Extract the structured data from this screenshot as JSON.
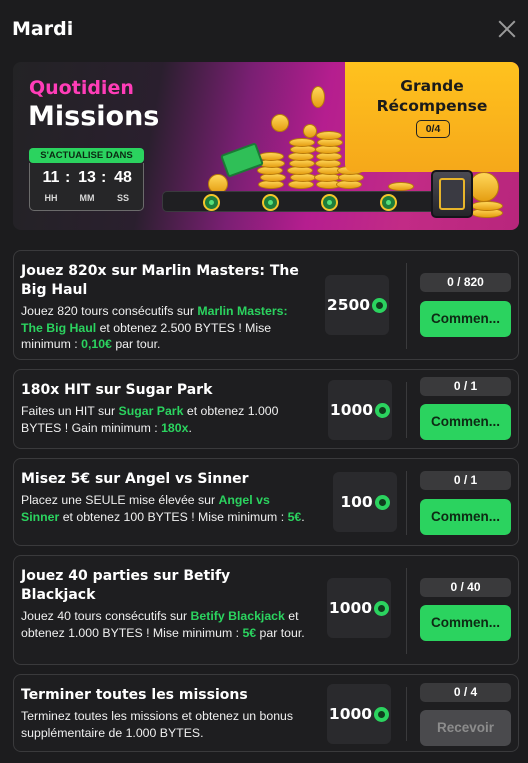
{
  "header": {
    "title": "Mardi"
  },
  "banner": {
    "label_top": "Quotidien",
    "label_main": "Missions",
    "refresh_label": "S'ACTUALISE DANS",
    "timer": {
      "hh": "11",
      "mm": "13",
      "ss": "48",
      "hh_label": "HH",
      "mm_label": "MM",
      "ss_label": "SS",
      "sep": ":"
    },
    "reward": {
      "title_line1": "Grande",
      "title_line2": "Récompense",
      "count": "0/4"
    },
    "progress_fraction": 0
  },
  "missions": [
    {
      "title": "Jouez 820x sur Marlin Masters: The Big Haul",
      "desc": [
        {
          "t": "Jouez 820 tours consécutifs sur "
        },
        {
          "t": "Marlin Masters: The Big Haul",
          "c": "hl"
        },
        {
          "t": " et obtenez 2.500 BYTES ! Mise minimum : "
        },
        {
          "t": "0,10€",
          "c": "hl"
        },
        {
          "t": " par tour."
        }
      ],
      "amount": "2500",
      "progress": "0 / 820",
      "button": "Commen...",
      "enabled": true
    },
    {
      "title": "180x HIT sur Sugar Park",
      "desc": [
        {
          "t": "Faites un HIT sur "
        },
        {
          "t": "Sugar Park",
          "c": "hl"
        },
        {
          "t": " et obtenez 1.000 BYTES ! Gain minimum : "
        },
        {
          "t": "180x",
          "c": "hl"
        },
        {
          "t": "."
        }
      ],
      "amount": "1000",
      "progress": "0 / 1",
      "button": "Commen...",
      "enabled": true
    },
    {
      "title": "Misez 5€ sur Angel vs Sinner",
      "desc": [
        {
          "t": "Placez une SEULE mise élevée sur "
        },
        {
          "t": "Angel vs Sinner",
          "c": "hl"
        },
        {
          "t": " et obtenez 100 BYTES ! Mise minimum : "
        },
        {
          "t": "5€",
          "c": "hl"
        },
        {
          "t": "."
        }
      ],
      "amount": "100",
      "progress": "0 / 1",
      "button": "Commen...",
      "enabled": true
    },
    {
      "title": "Jouez 40 parties sur Betify Blackjack",
      "desc": [
        {
          "t": "Jouez 40 tours consécutifs sur "
        },
        {
          "t": "Betify Blackjack",
          "c": "hl"
        },
        {
          "t": " et obtenez 1.000 BYTES ! Mise minimum : "
        },
        {
          "t": "5€",
          "c": "hl"
        },
        {
          "t": " par tour."
        }
      ],
      "amount": "1000",
      "progress": "0 / 40",
      "button": "Commen...",
      "enabled": true
    },
    {
      "title": "Terminer toutes les missions",
      "desc": [
        {
          "t": "Terminez toutes les missions et obtenez un bonus supplémentaire de 1.000 BYTES."
        }
      ],
      "amount": "1000",
      "progress": "0 / 4",
      "button": "Recevoir",
      "enabled": false
    }
  ]
}
